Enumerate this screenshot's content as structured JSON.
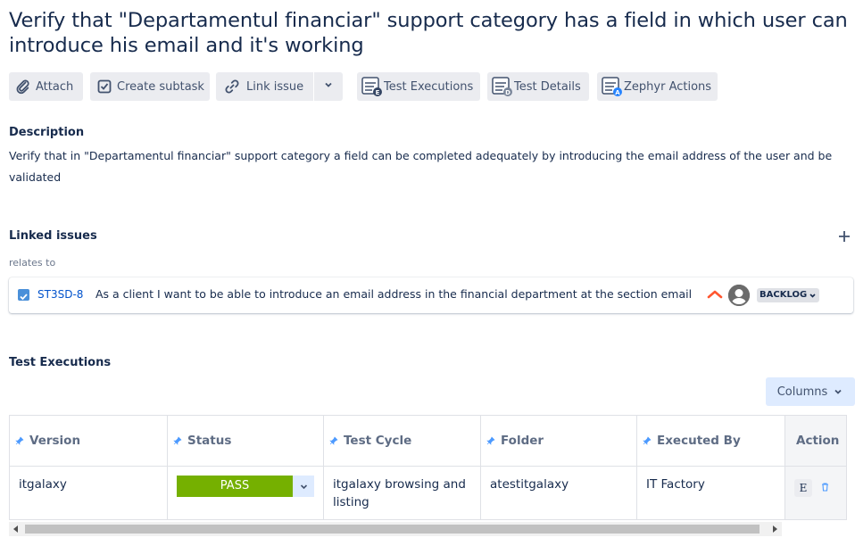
{
  "issue": {
    "title_line1": "Verify that \"Departamentul financiar\" support category has a field in which user can",
    "title_line2": "introduce his email and it's working"
  },
  "toolbar": {
    "attach": "Attach",
    "create_subtask": "Create subtask",
    "link_issue": "Link issue",
    "test_executions": "Test Executions",
    "test_details": "Test Details",
    "zephyr_actions": "Zephyr Actions"
  },
  "description": {
    "heading": "Description",
    "text": "Verify that in \"Departamentul financiar\" support category a field can be completed adequately by introducing the email address of the user and be validated"
  },
  "linked": {
    "heading": "Linked issues",
    "relation": "relates to",
    "items": [
      {
        "key": "ST3SD-8",
        "summary": "As a client I want to be able to introduce an email address in the financial department at the section email",
        "status": "BACKLOG"
      }
    ]
  },
  "test_executions": {
    "heading": "Test Executions",
    "columns_button": "Columns",
    "headers": [
      "Version",
      "Status",
      "Test Cycle",
      "Folder",
      "Executed By",
      "Action"
    ],
    "rows": [
      {
        "version": "itgalaxy",
        "status": "PASS",
        "test_cycle": "itgalaxy browsing and listing",
        "folder": "atestitgalaxy",
        "executed_by": "IT Factory",
        "action_execute": "E"
      }
    ]
  },
  "colors": {
    "pass": "#75b000",
    "link": "#0052cc",
    "priority_high": "#ff5630",
    "button_bg": "#ebecf0"
  }
}
